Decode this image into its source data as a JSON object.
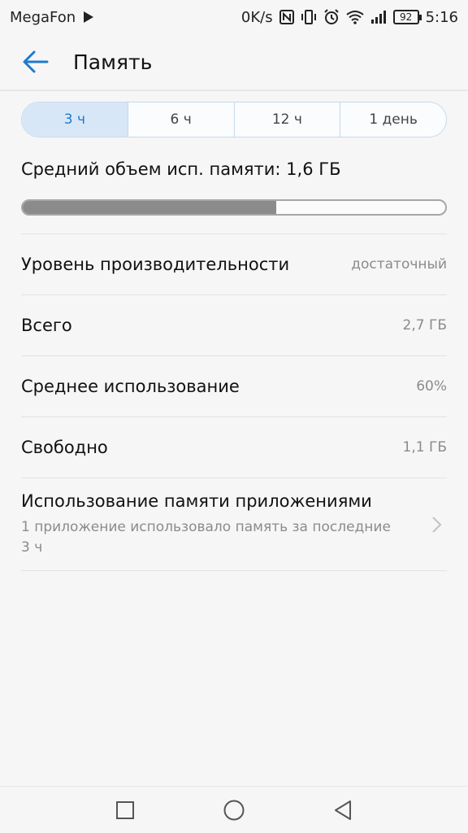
{
  "status_bar": {
    "carrier": "MegaFon",
    "network_speed": "0K/s",
    "battery": "92",
    "time": "5:16",
    "icons": [
      "play-store-icon",
      "nfc-icon",
      "vibrate-icon",
      "alarm-icon",
      "wifi-icon",
      "signal-icon",
      "battery-icon"
    ]
  },
  "header": {
    "title": "Память"
  },
  "tabs": [
    {
      "label": "3 ч",
      "active": true
    },
    {
      "label": "6 ч",
      "active": false
    },
    {
      "label": "12 ч",
      "active": false
    },
    {
      "label": "1 день",
      "active": false
    }
  ],
  "summary": {
    "average_label": "Средний объем исп. памяти: 1,6 ГБ",
    "usage_fraction": 0.6
  },
  "rows": [
    {
      "label": "Уровень производительности",
      "value": "достаточный"
    },
    {
      "label": "Всего",
      "value": "2,7 ГБ"
    },
    {
      "label": "Среднее использование",
      "value": "60%"
    },
    {
      "label": "Свободно",
      "value": "1,1 ГБ"
    }
  ],
  "app_usage": {
    "title": "Использование памяти приложениями",
    "subtitle": "1 приложение использовало память за последние 3 ч"
  },
  "colors": {
    "accent": "#1f7ad0",
    "progress_fill": "#8b8b8b",
    "text_secondary": "#8b8b8b"
  }
}
